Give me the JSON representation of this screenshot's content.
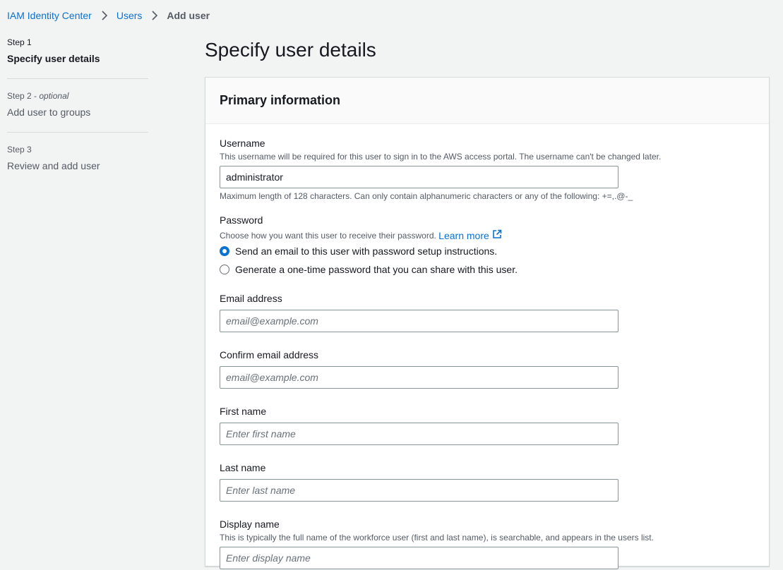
{
  "breadcrumb": {
    "root": "IAM Identity Center",
    "users": "Users",
    "current": "Add user"
  },
  "steps": [
    {
      "number": "Step 1",
      "optional": "",
      "title": "Specify user details",
      "active": true
    },
    {
      "number": "Step 2",
      "optional": "optional",
      "title": "Add user to groups",
      "active": false
    },
    {
      "number": "Step 3",
      "optional": "",
      "title": "Review and add user",
      "active": false
    }
  ],
  "page_title": "Specify user details",
  "panel": {
    "title": "Primary information",
    "username": {
      "label": "Username",
      "description": "This username will be required for this user to sign in to the AWS access portal. The username can't be changed later.",
      "value": "administrator",
      "hint": "Maximum length of 128 characters. Can only contain alphanumeric characters or any of the following: +=,.@-_"
    },
    "password": {
      "label": "Password",
      "description": "Choose how you want this user to receive their password.",
      "learn_more": "Learn more",
      "options": [
        {
          "label": "Send an email to this user with password setup instructions.",
          "checked": true
        },
        {
          "label": "Generate a one-time password that you can share with this user.",
          "checked": false
        }
      ]
    },
    "email": {
      "label": "Email address",
      "placeholder": "email@example.com"
    },
    "confirm_email": {
      "label": "Confirm email address",
      "placeholder": "email@example.com"
    },
    "first_name": {
      "label": "First name",
      "placeholder": "Enter first name"
    },
    "last_name": {
      "label": "Last name",
      "placeholder": "Enter last name"
    },
    "display_name": {
      "label": "Display name",
      "description": "This is typically the full name of the workforce user (first and last name), is searchable, and appears in the users list.",
      "placeholder": "Enter display name"
    }
  },
  "colors": {
    "link": "#0972d3",
    "background": "#f2f3f3",
    "panel": "#ffffff"
  }
}
